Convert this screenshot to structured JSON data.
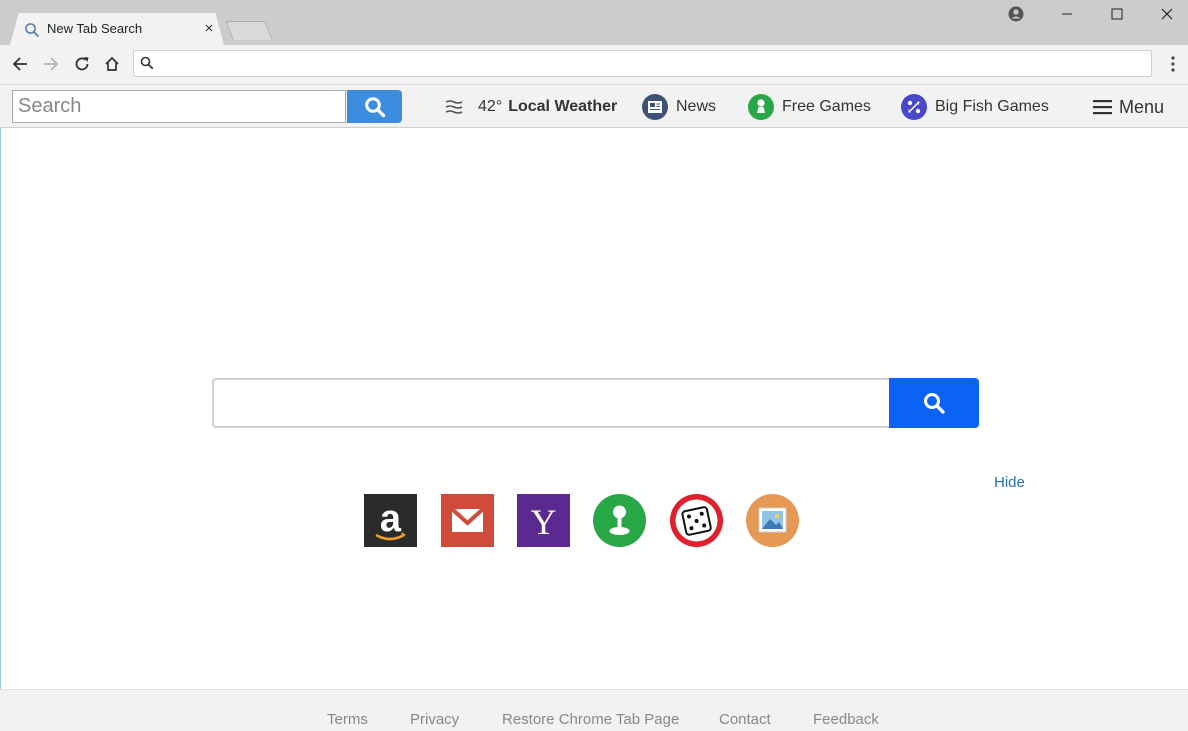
{
  "browser": {
    "tab_title": "New Tab Search",
    "tab_close": "×",
    "omnibox_value": ""
  },
  "toolbar": {
    "search_placeholder": "Search",
    "weather_temp": "42°",
    "weather_label": "Local Weather",
    "news_label": "News",
    "free_games_label": "Free Games",
    "big_fish_label": "Big Fish Games",
    "menu_label": "Menu"
  },
  "main": {
    "search_value": "",
    "hide_label": "Hide",
    "tiles": [
      {
        "icon": "amazon-icon",
        "glyph": "a",
        "color": "#2b2b2b"
      },
      {
        "icon": "gmail-icon",
        "color": "#d14b3a"
      },
      {
        "icon": "yahoo-icon",
        "glyph": "Y",
        "color": "#5b2a8f"
      },
      {
        "icon": "free-games-icon",
        "color": "#27a745"
      },
      {
        "icon": "dice-icon",
        "color": "#e0202d"
      },
      {
        "icon": "picture-icon",
        "color": "#e59954"
      }
    ]
  },
  "footer": {
    "links": [
      "Terms",
      "Privacy",
      "Restore Chrome Tab Page",
      "Contact",
      "Feedback"
    ]
  },
  "colors": {
    "search_button": "#0b63f6",
    "ext_search_button": "#3c8dde",
    "link": "#2a6fb8"
  }
}
